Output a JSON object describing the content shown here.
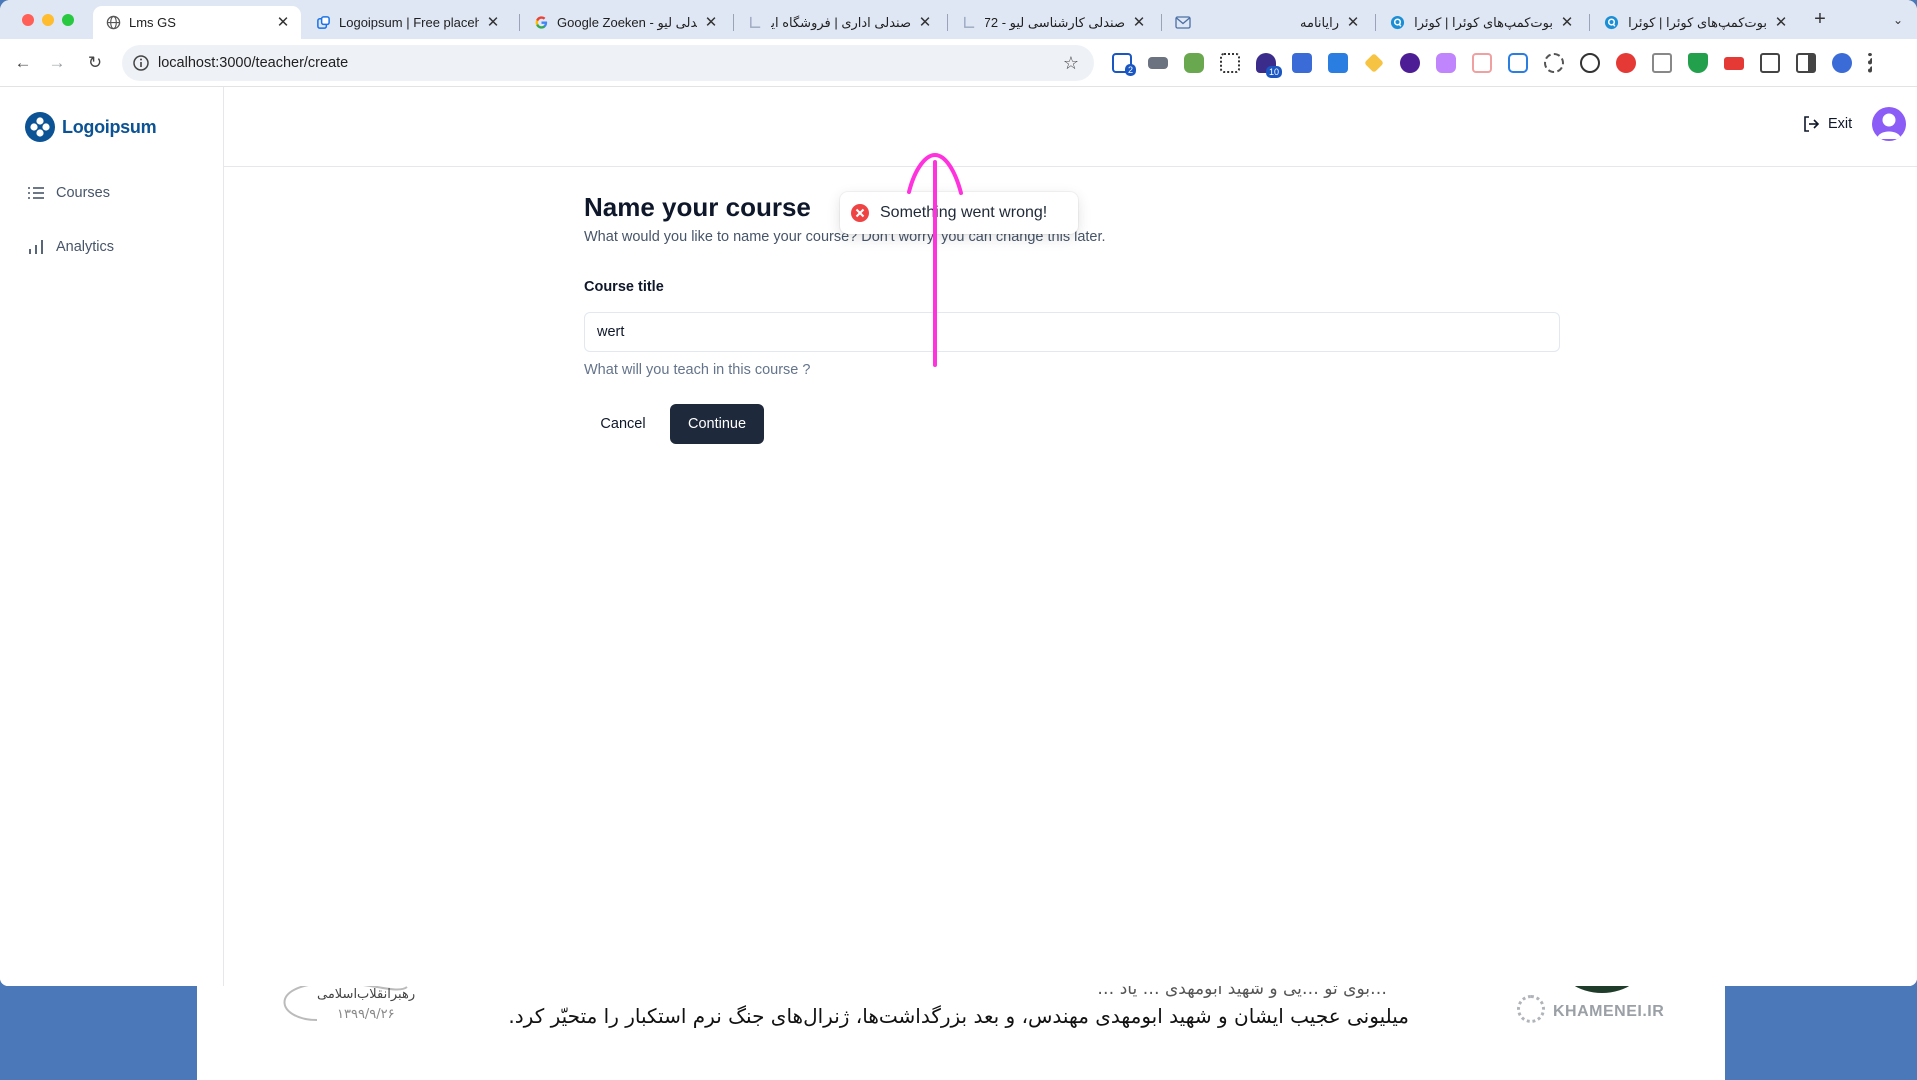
{
  "browser": {
    "tabs": [
      {
        "title": "Lms GS",
        "icon": "globe-icon",
        "active": true
      },
      {
        "title": "Logoipsum | Free placeho",
        "icon": "logoipsum-favicon",
        "active": false
      },
      {
        "title": "Google Zoeken - صندلی لیو",
        "icon": "google-favicon",
        "active": false
      },
      {
        "title": "صندلی اداری | فروشگاه اینترنتی",
        "icon": "page-favicon",
        "active": false
      },
      {
        "title": "صندلی کارشناسی لیو - I72",
        "icon": "page-favicon",
        "active": false
      },
      {
        "title": "رایانامه",
        "icon": "mail-favicon",
        "active": false
      },
      {
        "title": "بوت‌کمپ‌های کوئرا | کوئرا",
        "icon": "quera-favicon",
        "active": false
      },
      {
        "title": "بوت‌کمپ‌های کوئرا | کوئرا",
        "icon": "quera-favicon",
        "active": false
      }
    ],
    "url": "localhost:3000/teacher/create",
    "extension_badges": {
      "first": "2",
      "second": "10"
    }
  },
  "sidebar": {
    "logo_text": "Logoipsum",
    "items": [
      {
        "label": "Courses",
        "icon": "list-icon"
      },
      {
        "label": "Analytics",
        "icon": "bar-chart-icon"
      }
    ]
  },
  "topbar": {
    "exit_label": "Exit"
  },
  "toast": {
    "message": "Something went wrong!",
    "color": "#ef4444"
  },
  "form": {
    "title": "Name your course",
    "subtitle": "What would you like to name your course? Don't worry, you can change this later.",
    "field_label": "Course title",
    "field_value": "wert",
    "field_help": "What will you teach in this course ?",
    "cancel_label": "Cancel",
    "continue_label": "Continue"
  },
  "annotation": {
    "color": "#ff33dd",
    "icon": "arrow-up-annotation"
  },
  "wallpaper": {
    "line_1": "…بوی تو …یی و شهید ابومهدی … یاد …",
    "line_2": "میلیونی عجیب ایشان و شهید ابومهدی مهندس، و بعد بزرگداشت‌ها، ژنرال‌های جنگ نرم استکبار را متحیّر کرد.",
    "signature_text": "رهبرانقلاب‌اسلامی",
    "signature_date": "۱۳۹۹/۹/۲۶",
    "brand": "KHAMENEI.IR"
  }
}
